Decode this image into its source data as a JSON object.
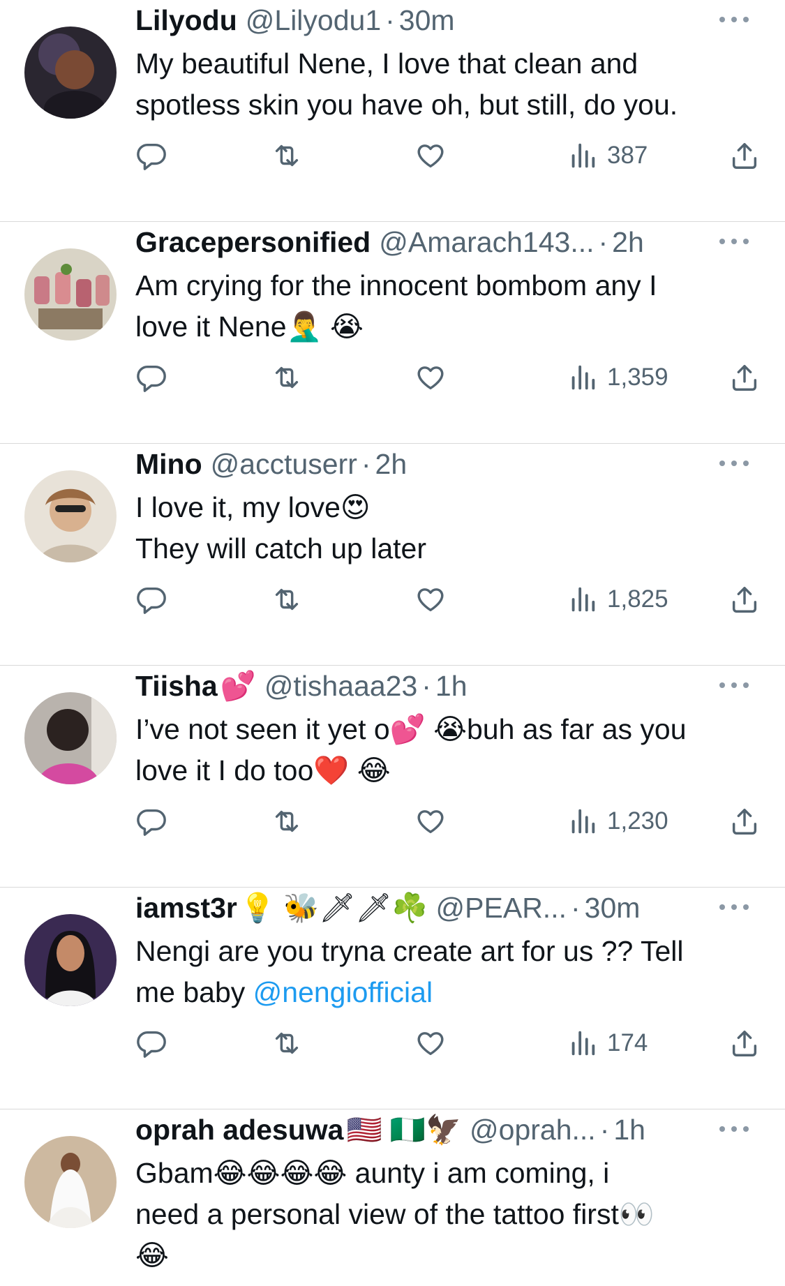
{
  "colors": {
    "text": "#0f1419",
    "muted": "#536471",
    "link": "#1d9bf0",
    "divider": "#d9d9d9"
  },
  "icons": [
    "reply-icon",
    "retweet-icon",
    "like-icon",
    "views-icon",
    "share-icon",
    "more-icon"
  ],
  "replies": [
    {
      "name": "Lilyodu",
      "name_emoji": "",
      "handle": "@Lilyodu1",
      "time": "30m",
      "lines": [
        "My beautiful Nene,  I love that clean and",
        "spotless skin you have oh, but still,  do you."
      ],
      "mention": "",
      "views": "387"
    },
    {
      "name": "Gracepersonified",
      "name_emoji": "",
      "handle": "@Amarach143...",
      "time": "2h",
      "lines": [
        "Am crying for the innocent bombom any I",
        "love it Nene🤦‍♂️ 😭"
      ],
      "mention": "",
      "views": "1,359"
    },
    {
      "name": "Mino",
      "name_emoji": "",
      "handle": "@acctuserr",
      "time": "2h",
      "lines": [
        "I love it, my love😍",
        "They will catch up later"
      ],
      "mention": "",
      "views": "1,825"
    },
    {
      "name": "Tiisha",
      "name_emoji": "💕",
      "handle": "@tishaaa23",
      "time": "1h",
      "lines": [
        "I’ve not seen it yet o💕 😭buh as far as you",
        "love it I do too❤️ 😂"
      ],
      "mention": "",
      "views": "1,230"
    },
    {
      "name": "iamst3r",
      "name_emoji": "💡 🐝🗡🗡☘️",
      "handle": "@PEAR...",
      "time": "30m",
      "lines": [
        "Nengi are you tryna create art for us ?? Tell",
        "me baby "
      ],
      "mention": "@nengiofficial",
      "views": "174"
    },
    {
      "name": "oprah adesuwa",
      "name_emoji": "🇺🇸 🇳🇬🦅",
      "handle": "@oprah...",
      "time": "1h",
      "lines": [
        "Gbam😂😂😂😂 aunty i am coming, i",
        "need a personal view of the tattoo first👀",
        "😂"
      ],
      "mention": "",
      "views": ""
    }
  ]
}
